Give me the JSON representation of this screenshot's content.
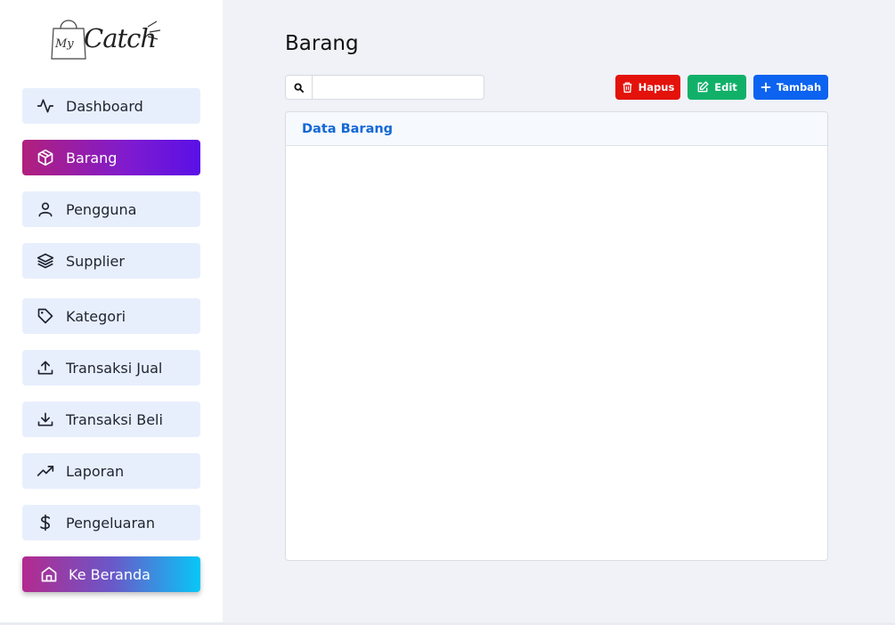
{
  "app": {
    "logo_text": "Catch",
    "logo_prefix": "My"
  },
  "sidebar": {
    "items": [
      {
        "label": "Dashboard",
        "icon": "activity-icon"
      },
      {
        "label": "Barang",
        "icon": "box-icon",
        "active": true
      },
      {
        "label": "Pengguna",
        "icon": "user-icon"
      },
      {
        "label": "Supplier",
        "icon": "layers-icon"
      },
      {
        "label": "Kategori",
        "icon": "tag-icon"
      },
      {
        "label": "Transaksi Jual",
        "icon": "upload-icon"
      },
      {
        "label": "Transaksi Beli",
        "icon": "download-icon"
      },
      {
        "label": "Laporan",
        "icon": "trending-up-icon"
      },
      {
        "label": "Pengeluaran",
        "icon": "dollar-icon"
      },
      {
        "label": "Ke Beranda",
        "icon": "home-icon"
      }
    ]
  },
  "main": {
    "title": "Barang",
    "search": {
      "value": "",
      "placeholder": "",
      "icon": "search-icon"
    },
    "buttons": {
      "hapus": "Hapus",
      "edit": "Edit",
      "tambah": "Tambah"
    },
    "card": {
      "title": "Data Barang"
    }
  },
  "colors": {
    "active_gradient": [
      "#b1207c",
      "#5a10e6"
    ],
    "home_gradient": [
      "#b32a8f",
      "#08c7f7"
    ],
    "hapus": "#e3120b",
    "edit": "#11b069",
    "tambah": "#0b63f0",
    "card_title": "#1468d6"
  }
}
